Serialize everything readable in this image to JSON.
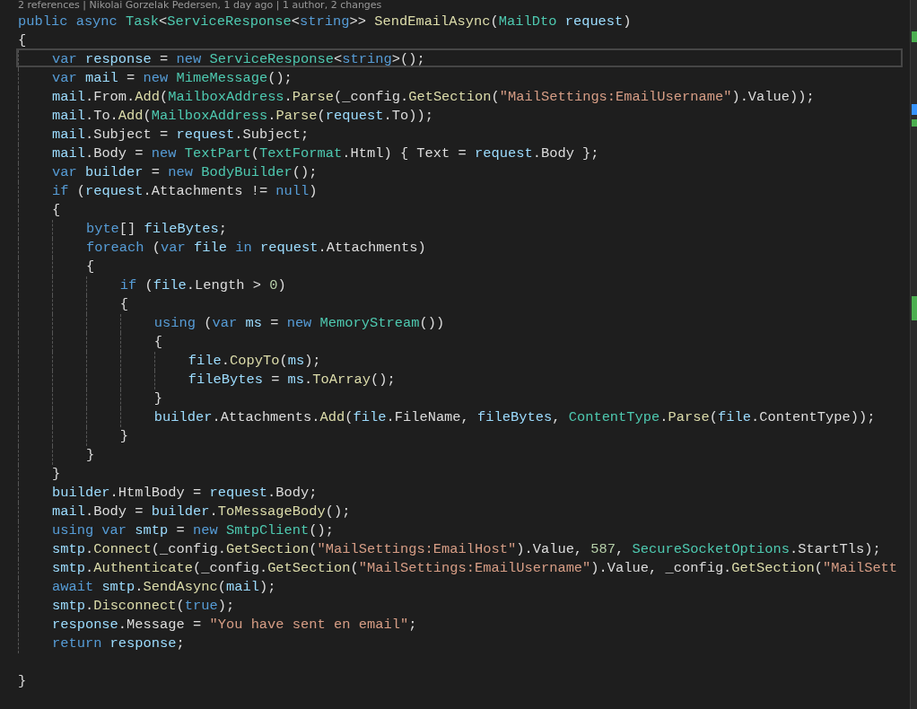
{
  "codelens": "2 references | Nikolai Gorzelak Pedersen, 1 day ago | 1 author, 2 changes",
  "lines": [
    {
      "kind": "code",
      "current": false,
      "tokens": [
        {
          "kind": "keyword",
          "text": "public async "
        },
        {
          "kind": "type",
          "text": "Task"
        },
        {
          "kind": "plain",
          "text": "<"
        },
        {
          "kind": "type",
          "text": "ServiceResponse"
        },
        {
          "kind": "plain",
          "text": "<"
        },
        {
          "kind": "keyword",
          "text": "string"
        },
        {
          "kind": "plain",
          "text": ">> "
        },
        {
          "kind": "method",
          "text": "SendEmailAsync"
        },
        {
          "kind": "plain",
          "text": "("
        },
        {
          "kind": "type",
          "text": "MailDto"
        },
        {
          "kind": "variable",
          "text": " request"
        },
        {
          "kind": "plain",
          "text": ")"
        }
      ]
    },
    {
      "kind": "code",
      "current": false,
      "tokens": [
        {
          "kind": "plain",
          "text": "{"
        }
      ]
    },
    {
      "kind": "code",
      "current": true,
      "tokens": [
        {
          "kind": "keyword",
          "text": "    var "
        },
        {
          "kind": "variable",
          "text": "response"
        },
        {
          "kind": "plain",
          "text": " = "
        },
        {
          "kind": "keyword",
          "text": "new "
        },
        {
          "kind": "type",
          "text": "ServiceResponse"
        },
        {
          "kind": "plain",
          "text": "<"
        },
        {
          "kind": "keyword",
          "text": "string"
        },
        {
          "kind": "plain",
          "text": ">();"
        }
      ]
    },
    {
      "kind": "code",
      "current": false,
      "tokens": [
        {
          "kind": "keyword",
          "text": "    var "
        },
        {
          "kind": "variable",
          "text": "mail"
        },
        {
          "kind": "plain",
          "text": " = "
        },
        {
          "kind": "keyword",
          "text": "new "
        },
        {
          "kind": "type",
          "text": "MimeMessage"
        },
        {
          "kind": "plain",
          "text": "();"
        }
      ]
    },
    {
      "kind": "code",
      "current": false,
      "tokens": [
        {
          "kind": "variable",
          "text": "    mail"
        },
        {
          "kind": "plain",
          "text": ".From."
        },
        {
          "kind": "method",
          "text": "Add"
        },
        {
          "kind": "plain",
          "text": "("
        },
        {
          "kind": "type",
          "text": "MailboxAddress"
        },
        {
          "kind": "plain",
          "text": "."
        },
        {
          "kind": "method",
          "text": "Parse"
        },
        {
          "kind": "plain",
          "text": "(_config."
        },
        {
          "kind": "method",
          "text": "GetSection"
        },
        {
          "kind": "plain",
          "text": "("
        },
        {
          "kind": "string",
          "text": "\"MailSettings:EmailUsername\""
        },
        {
          "kind": "plain",
          "text": ").Value));"
        }
      ]
    },
    {
      "kind": "code",
      "current": false,
      "tokens": [
        {
          "kind": "variable",
          "text": "    mail"
        },
        {
          "kind": "plain",
          "text": ".To."
        },
        {
          "kind": "method",
          "text": "Add"
        },
        {
          "kind": "plain",
          "text": "("
        },
        {
          "kind": "type",
          "text": "MailboxAddress"
        },
        {
          "kind": "plain",
          "text": "."
        },
        {
          "kind": "method",
          "text": "Parse"
        },
        {
          "kind": "plain",
          "text": "("
        },
        {
          "kind": "variable",
          "text": "request"
        },
        {
          "kind": "plain",
          "text": ".To));"
        }
      ]
    },
    {
      "kind": "code",
      "current": false,
      "tokens": [
        {
          "kind": "variable",
          "text": "    mail"
        },
        {
          "kind": "plain",
          "text": ".Subject = "
        },
        {
          "kind": "variable",
          "text": "request"
        },
        {
          "kind": "plain",
          "text": ".Subject;"
        }
      ]
    },
    {
      "kind": "code",
      "current": false,
      "tokens": [
        {
          "kind": "variable",
          "text": "    mail"
        },
        {
          "kind": "plain",
          "text": ".Body = "
        },
        {
          "kind": "keyword",
          "text": "new "
        },
        {
          "kind": "type",
          "text": "TextPart"
        },
        {
          "kind": "plain",
          "text": "("
        },
        {
          "kind": "type",
          "text": "TextFormat"
        },
        {
          "kind": "plain",
          "text": ".Html) { Text = "
        },
        {
          "kind": "variable",
          "text": "request"
        },
        {
          "kind": "plain",
          "text": ".Body };"
        }
      ]
    },
    {
      "kind": "code",
      "current": false,
      "tokens": [
        {
          "kind": "keyword",
          "text": "    var "
        },
        {
          "kind": "variable",
          "text": "builder"
        },
        {
          "kind": "plain",
          "text": " = "
        },
        {
          "kind": "keyword",
          "text": "new "
        },
        {
          "kind": "type",
          "text": "BodyBuilder"
        },
        {
          "kind": "plain",
          "text": "();"
        }
      ]
    },
    {
      "kind": "code",
      "current": false,
      "tokens": [
        {
          "kind": "keyword",
          "text": "    if "
        },
        {
          "kind": "plain",
          "text": "("
        },
        {
          "kind": "variable",
          "text": "request"
        },
        {
          "kind": "plain",
          "text": ".Attachments != "
        },
        {
          "kind": "keyword",
          "text": "null"
        },
        {
          "kind": "plain",
          "text": ")"
        }
      ]
    },
    {
      "kind": "code",
      "current": false,
      "tokens": [
        {
          "kind": "plain",
          "text": "    {"
        }
      ]
    },
    {
      "kind": "code",
      "current": false,
      "tokens": [
        {
          "kind": "keyword",
          "text": "        byte"
        },
        {
          "kind": "plain",
          "text": "[] "
        },
        {
          "kind": "variable",
          "text": "fileBytes"
        },
        {
          "kind": "plain",
          "text": ";"
        }
      ]
    },
    {
      "kind": "code",
      "current": false,
      "tokens": [
        {
          "kind": "keyword",
          "text": "        foreach "
        },
        {
          "kind": "plain",
          "text": "("
        },
        {
          "kind": "keyword",
          "text": "var "
        },
        {
          "kind": "variable",
          "text": "file "
        },
        {
          "kind": "keyword",
          "text": "in "
        },
        {
          "kind": "variable",
          "text": "request"
        },
        {
          "kind": "plain",
          "text": ".Attachments)"
        }
      ]
    },
    {
      "kind": "code",
      "current": false,
      "tokens": [
        {
          "kind": "plain",
          "text": "        {"
        }
      ]
    },
    {
      "kind": "code",
      "current": false,
      "tokens": [
        {
          "kind": "keyword",
          "text": "            if "
        },
        {
          "kind": "plain",
          "text": "("
        },
        {
          "kind": "variable",
          "text": "file"
        },
        {
          "kind": "plain",
          "text": ".Length > "
        },
        {
          "kind": "number",
          "text": "0"
        },
        {
          "kind": "plain",
          "text": ")"
        }
      ]
    },
    {
      "kind": "code",
      "current": false,
      "tokens": [
        {
          "kind": "plain",
          "text": "            {"
        }
      ]
    },
    {
      "kind": "code",
      "current": false,
      "tokens": [
        {
          "kind": "keyword",
          "text": "                using "
        },
        {
          "kind": "plain",
          "text": "("
        },
        {
          "kind": "keyword",
          "text": "var "
        },
        {
          "kind": "variable",
          "text": "ms"
        },
        {
          "kind": "plain",
          "text": " = "
        },
        {
          "kind": "keyword",
          "text": "new "
        },
        {
          "kind": "type",
          "text": "MemoryStream"
        },
        {
          "kind": "plain",
          "text": "())"
        }
      ]
    },
    {
      "kind": "code",
      "current": false,
      "tokens": [
        {
          "kind": "plain",
          "text": "                {"
        }
      ]
    },
    {
      "kind": "code",
      "current": false,
      "tokens": [
        {
          "kind": "variable",
          "text": "                    file"
        },
        {
          "kind": "plain",
          "text": "."
        },
        {
          "kind": "method",
          "text": "CopyTo"
        },
        {
          "kind": "plain",
          "text": "("
        },
        {
          "kind": "variable",
          "text": "ms"
        },
        {
          "kind": "plain",
          "text": ");"
        }
      ]
    },
    {
      "kind": "code",
      "current": false,
      "tokens": [
        {
          "kind": "variable",
          "text": "                    fileBytes"
        },
        {
          "kind": "plain",
          "text": " = "
        },
        {
          "kind": "variable",
          "text": "ms"
        },
        {
          "kind": "plain",
          "text": "."
        },
        {
          "kind": "method",
          "text": "ToArray"
        },
        {
          "kind": "plain",
          "text": "();"
        }
      ]
    },
    {
      "kind": "code",
      "current": false,
      "tokens": [
        {
          "kind": "plain",
          "text": "                }"
        }
      ]
    },
    {
      "kind": "code",
      "current": false,
      "tokens": [
        {
          "kind": "variable",
          "text": "                builder"
        },
        {
          "kind": "plain",
          "text": ".Attachments."
        },
        {
          "kind": "method",
          "text": "Add"
        },
        {
          "kind": "plain",
          "text": "("
        },
        {
          "kind": "variable",
          "text": "file"
        },
        {
          "kind": "plain",
          "text": ".FileName, "
        },
        {
          "kind": "variable",
          "text": "fileBytes"
        },
        {
          "kind": "plain",
          "text": ", "
        },
        {
          "kind": "type",
          "text": "ContentType"
        },
        {
          "kind": "plain",
          "text": "."
        },
        {
          "kind": "method",
          "text": "Parse"
        },
        {
          "kind": "plain",
          "text": "("
        },
        {
          "kind": "variable",
          "text": "file"
        },
        {
          "kind": "plain",
          "text": ".ContentType));"
        }
      ]
    },
    {
      "kind": "code",
      "current": false,
      "tokens": [
        {
          "kind": "plain",
          "text": "            }"
        }
      ]
    },
    {
      "kind": "code",
      "current": false,
      "tokens": [
        {
          "kind": "plain",
          "text": "        }"
        }
      ]
    },
    {
      "kind": "code",
      "current": false,
      "tokens": [
        {
          "kind": "plain",
          "text": "    }"
        }
      ]
    },
    {
      "kind": "code",
      "current": false,
      "tokens": [
        {
          "kind": "variable",
          "text": "    builder"
        },
        {
          "kind": "plain",
          "text": ".HtmlBody = "
        },
        {
          "kind": "variable",
          "text": "request"
        },
        {
          "kind": "plain",
          "text": ".Body;"
        }
      ]
    },
    {
      "kind": "code",
      "current": false,
      "tokens": [
        {
          "kind": "variable",
          "text": "    mail"
        },
        {
          "kind": "plain",
          "text": ".Body = "
        },
        {
          "kind": "variable",
          "text": "builder"
        },
        {
          "kind": "plain",
          "text": "."
        },
        {
          "kind": "method",
          "text": "ToMessageBody"
        },
        {
          "kind": "plain",
          "text": "();"
        }
      ]
    },
    {
      "kind": "code",
      "current": false,
      "tokens": [
        {
          "kind": "keyword",
          "text": "    using var "
        },
        {
          "kind": "variable",
          "text": "smtp"
        },
        {
          "kind": "plain",
          "text": " = "
        },
        {
          "kind": "keyword",
          "text": "new "
        },
        {
          "kind": "type",
          "text": "SmtpClient"
        },
        {
          "kind": "plain",
          "text": "();"
        }
      ]
    },
    {
      "kind": "code",
      "current": false,
      "tokens": [
        {
          "kind": "variable",
          "text": "    smtp"
        },
        {
          "kind": "plain",
          "text": "."
        },
        {
          "kind": "method",
          "text": "Connect"
        },
        {
          "kind": "plain",
          "text": "(_config."
        },
        {
          "kind": "method",
          "text": "GetSection"
        },
        {
          "kind": "plain",
          "text": "("
        },
        {
          "kind": "string",
          "text": "\"MailSettings:EmailHost\""
        },
        {
          "kind": "plain",
          "text": ").Value, "
        },
        {
          "kind": "number",
          "text": "587"
        },
        {
          "kind": "plain",
          "text": ", "
        },
        {
          "kind": "type",
          "text": "SecureSocketOptions"
        },
        {
          "kind": "plain",
          "text": ".StartTls);"
        }
      ]
    },
    {
      "kind": "code",
      "current": false,
      "tokens": [
        {
          "kind": "variable",
          "text": "    smtp"
        },
        {
          "kind": "plain",
          "text": "."
        },
        {
          "kind": "method",
          "text": "Authenticate"
        },
        {
          "kind": "plain",
          "text": "(_config."
        },
        {
          "kind": "method",
          "text": "GetSection"
        },
        {
          "kind": "plain",
          "text": "("
        },
        {
          "kind": "string",
          "text": "\"MailSettings:EmailUsername\""
        },
        {
          "kind": "plain",
          "text": ").Value, _config."
        },
        {
          "kind": "method",
          "text": "GetSection"
        },
        {
          "kind": "plain",
          "text": "("
        },
        {
          "kind": "string",
          "text": "\"MailSett"
        }
      ]
    },
    {
      "kind": "code",
      "current": false,
      "tokens": [
        {
          "kind": "keyword",
          "text": "    await "
        },
        {
          "kind": "variable",
          "text": "smtp"
        },
        {
          "kind": "plain",
          "text": "."
        },
        {
          "kind": "method",
          "text": "SendAsync"
        },
        {
          "kind": "plain",
          "text": "("
        },
        {
          "kind": "variable",
          "text": "mail"
        },
        {
          "kind": "plain",
          "text": ");"
        }
      ]
    },
    {
      "kind": "code",
      "current": false,
      "tokens": [
        {
          "kind": "variable",
          "text": "    smtp"
        },
        {
          "kind": "plain",
          "text": "."
        },
        {
          "kind": "method",
          "text": "Disconnect"
        },
        {
          "kind": "plain",
          "text": "("
        },
        {
          "kind": "keyword",
          "text": "true"
        },
        {
          "kind": "plain",
          "text": ");"
        }
      ]
    },
    {
      "kind": "code",
      "current": false,
      "tokens": [
        {
          "kind": "variable",
          "text": "    response"
        },
        {
          "kind": "plain",
          "text": ".Message = "
        },
        {
          "kind": "string",
          "text": "\"You have sent en email\""
        },
        {
          "kind": "plain",
          "text": ";"
        }
      ]
    },
    {
      "kind": "code",
      "current": false,
      "tokens": [
        {
          "kind": "keyword",
          "text": "    return "
        },
        {
          "kind": "variable",
          "text": "response"
        },
        {
          "kind": "plain",
          "text": ";"
        }
      ]
    },
    {
      "kind": "blank",
      "current": false
    },
    {
      "kind": "code",
      "current": false,
      "tokens": [
        {
          "kind": "plain",
          "text": "}"
        }
      ]
    }
  ]
}
